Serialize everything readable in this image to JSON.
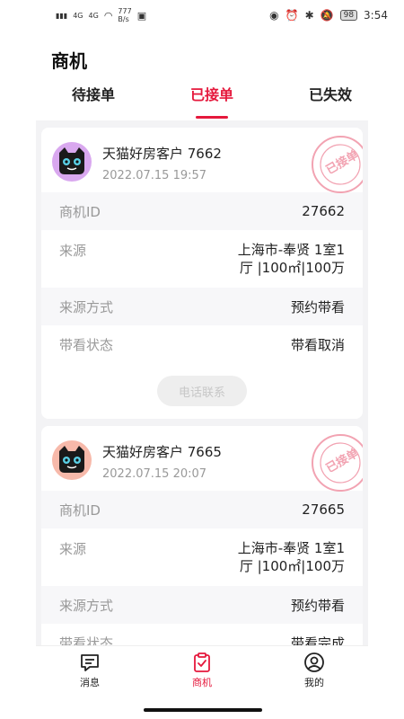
{
  "status_bar": {
    "net_speed": "777",
    "net_unit": "B/s",
    "signal1": "4G",
    "signal2": "4G",
    "battery": "98",
    "time": "3:54"
  },
  "page": {
    "title": "商机"
  },
  "tabs": [
    {
      "label": "待接单",
      "active": false
    },
    {
      "label": "已接单",
      "active": true
    },
    {
      "label": "已失效",
      "active": false
    }
  ],
  "cards": [
    {
      "name": "天猫好房客户 7662",
      "time": "2022.07.15 19:57",
      "stamp": "已接单",
      "rows": [
        {
          "label": "商机ID",
          "value": "27662"
        },
        {
          "label": "来源",
          "value_line1": "上海市-奉贤 1室1",
          "value_line2": "厅 |100㎡|100万"
        },
        {
          "label": "来源方式",
          "value": "预约带看"
        },
        {
          "label": "带看状态",
          "value": "带看取消"
        }
      ],
      "call_label": "电话联系"
    },
    {
      "name": "天猫好房客户 7665",
      "time": "2022.07.15 20:07",
      "stamp": "已接单",
      "rows": [
        {
          "label": "商机ID",
          "value": "27665"
        },
        {
          "label": "来源",
          "value_line1": "上海市-奉贤 1室1",
          "value_line2": "厅 |100㎡|100万"
        },
        {
          "label": "来源方式",
          "value": "预约带看"
        },
        {
          "label": "带看状态",
          "value": "带看完成"
        }
      ]
    }
  ],
  "bottom_nav": [
    {
      "label": "消息",
      "icon": "message-icon",
      "active": false
    },
    {
      "label": "商机",
      "icon": "clipboard-check-icon",
      "active": true
    },
    {
      "label": "我的",
      "icon": "user-icon",
      "active": false
    }
  ],
  "colors": {
    "accent": "#e5183c",
    "stamp": "#f2a3b2"
  }
}
